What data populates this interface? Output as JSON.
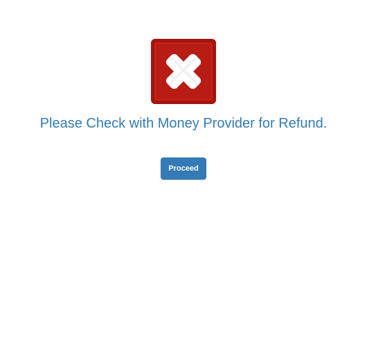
{
  "icon": {
    "name": "error-x-icon",
    "outer_color": "#a3150e",
    "inner_color": "#c8231a",
    "cross_color": "#ffffff"
  },
  "message": {
    "text": "Please Check with Money Provider for Refund.",
    "color": "#337ab7"
  },
  "actions": {
    "proceed_label": "Proceed",
    "button_color": "#337ab7"
  }
}
